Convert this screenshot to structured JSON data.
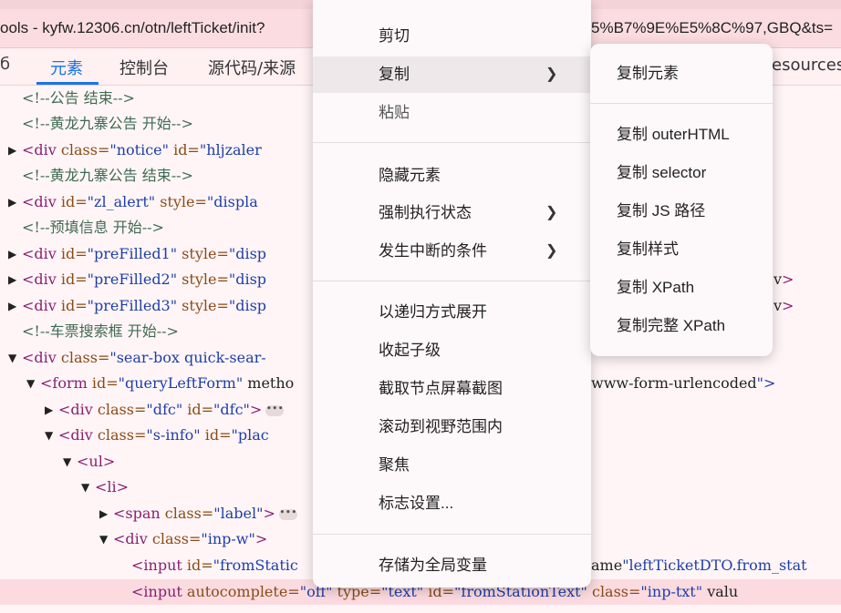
{
  "address": {
    "left": "ools - kyfw.12306.cn/otn/leftTicket/init?",
    "right": "5%B7%9E%E5%8C%97,GBQ&ts="
  },
  "tabs": [
    {
      "label": "元素",
      "active": true
    },
    {
      "label": "控制台",
      "active": false
    },
    {
      "label": "源代码/来源",
      "active": false
    }
  ],
  "tab_right_partial": "esources",
  "code_lines": [
    {
      "i": 0,
      "text": "<!--公告 结束-->"
    },
    {
      "i": 1,
      "text": "<!--黄龙九寨公告 开始-->"
    },
    {
      "i": 2,
      "tri": "▶",
      "text": "<div class=\"notice\" id=\"hljzaler"
    },
    {
      "i": 3,
      "text": "<!--黄龙九寨公告 结束-->"
    },
    {
      "i": 4,
      "tri": "▶",
      "text": "<div id=\"zl_alert\" style=\"displa"
    },
    {
      "i": 5,
      "text": "<!--预填信息 开始-->"
    },
    {
      "i": 6,
      "tri": "▶",
      "text": "<div id=\"preFilled1\" style=\"disp"
    },
    {
      "i": 7,
      "tri": "▶",
      "text": "<div id=\"preFilled2\" style=\"disp",
      "right": "v>"
    },
    {
      "i": 8,
      "tri": "▶",
      "text": "<div id=\"preFilled3\" style=\"disp",
      "right": "v>"
    },
    {
      "i": 9,
      "text": "<!--车票搜索框 开始-->"
    },
    {
      "i": 10,
      "tri": "▼",
      "text": "<div class=\"sear-box quick-sear-"
    },
    {
      "i": 11,
      "tri": "▼",
      "text": "<form id=\"queryLeftForm\" metho",
      "right": "www-form-urlencoded\">"
    },
    {
      "i": 12,
      "tri": "▶",
      "text": "<div class=\"dfc\" id=\"dfc\">"
    },
    {
      "i": 13,
      "tri": "▼",
      "text": "<div class=\"s-info\" id=\"plac"
    },
    {
      "i": 14,
      "tri": "▼",
      "text": "<ul>"
    },
    {
      "i": 15,
      "tri": "▼",
      "text": "<li>"
    },
    {
      "i": 16,
      "tri": "▶",
      "text": "<span class=\"label\">"
    },
    {
      "i": 17,
      "tri": "▼",
      "text": "<div class=\"inp-w\">"
    },
    {
      "i": 18,
      "text": "<input id=\"fromStatic",
      "right": "ame=\"leftTicketDTO.from_stat"
    },
    {
      "i": 19,
      "text": "<input autocomplete=\"off\" type=\"text\" id=\"fromStationText\" class=\"inp-txt\" valu"
    }
  ],
  "context_menu": {
    "items": [
      {
        "label": "剪切"
      },
      {
        "label": "复制",
        "submenu": true,
        "selected": true
      },
      {
        "label": "粘贴",
        "disabled": true
      },
      {
        "label": "隐藏元素"
      },
      {
        "label": "强制执行状态",
        "submenu": true
      },
      {
        "label": "发生中断的条件",
        "submenu": true
      },
      {
        "label": "以递归方式展开"
      },
      {
        "label": "收起子级"
      },
      {
        "label": "截取节点屏幕截图"
      },
      {
        "label": "滚动到视野范围内"
      },
      {
        "label": "聚焦"
      },
      {
        "label": "标志设置..."
      },
      {
        "label": "存储为全局变量"
      }
    ]
  },
  "submenu": {
    "items": [
      {
        "label": "复制元素"
      },
      {
        "label": "复制 outerHTML"
      },
      {
        "label": "复制 selector"
      },
      {
        "label": "复制 JS 路径"
      },
      {
        "label": "复制样式"
      },
      {
        "label": "复制 XPath"
      },
      {
        "label": "复制完整 XPath"
      }
    ]
  }
}
